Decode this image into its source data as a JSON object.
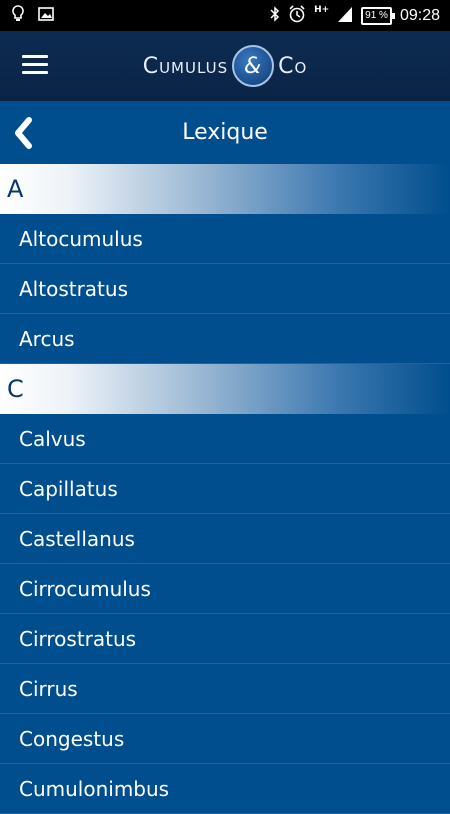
{
  "status_bar": {
    "time": "09:28",
    "battery": "91 %",
    "network": "H+",
    "icons": [
      "lightbulb-icon",
      "image-icon",
      "bluetooth-icon",
      "alarm-icon",
      "signal-icon",
      "battery-icon"
    ]
  },
  "app_bar": {
    "logo_left": "Cumulus",
    "logo_amp": "&",
    "logo_right": "Co"
  },
  "page": {
    "title": "Lexique"
  },
  "sections": [
    {
      "letter": "A",
      "items": [
        "Altocumulus",
        "Altostratus",
        "Arcus"
      ]
    },
    {
      "letter": "C",
      "items": [
        "Calvus",
        "Capillatus",
        "Castellanus",
        "Cirrocumulus",
        "Cirrostratus",
        "Cirrus",
        "Congestus",
        "Cumulonimbus"
      ]
    }
  ],
  "colors": {
    "background": "#004e8d",
    "app_bar": "#0b2748",
    "section_text": "#0a3670"
  }
}
